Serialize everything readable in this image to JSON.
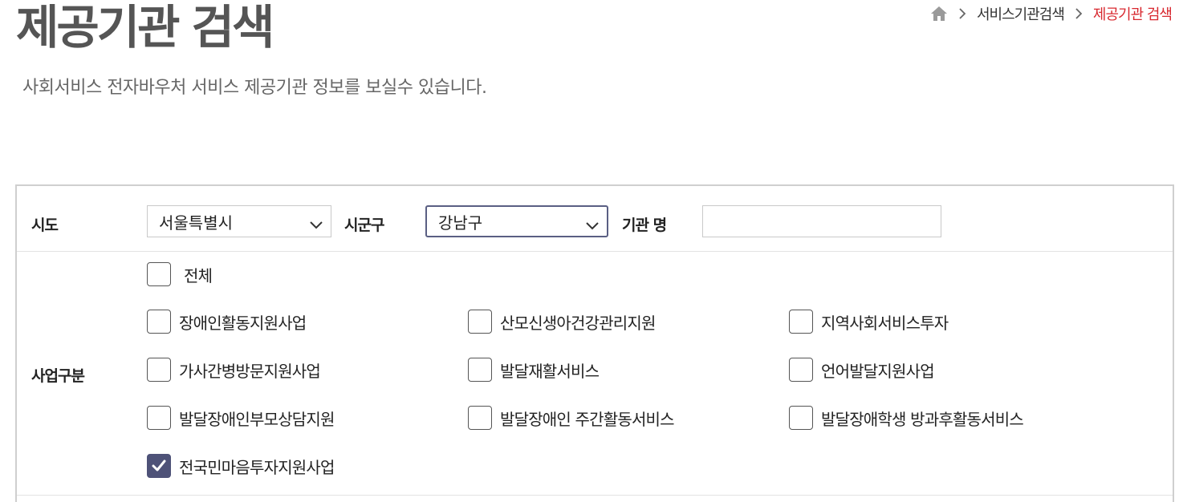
{
  "header": {
    "title": "제공기관 검색",
    "description": "사회서비스 전자바우처 서비스 제공기관 정보를 보실수 있습니다."
  },
  "breadcrumb": {
    "home_icon": "home-icon",
    "items": [
      "서비스기관검색",
      "제공기관 검색"
    ],
    "current_color": "#d8282f"
  },
  "search": {
    "sido_label": "시도",
    "sido_value": "서울특별시",
    "sigungu_label": "시군구",
    "sigungu_value": "강남구",
    "org_name_label": "기관 명",
    "org_name_value": "",
    "business_label": "사업구분",
    "all_label": "전체",
    "all_checked": false,
    "business_types": [
      {
        "label": "장애인활동지원사업",
        "checked": false
      },
      {
        "label": "산모신생아건강관리지원",
        "checked": false
      },
      {
        "label": "지역사회서비스투자",
        "checked": false
      },
      {
        "label": "가사간병방문지원사업",
        "checked": false
      },
      {
        "label": "발달재활서비스",
        "checked": false
      },
      {
        "label": "언어발달지원사업",
        "checked": false
      },
      {
        "label": "발달장애인부모상담지원",
        "checked": false
      },
      {
        "label": "발달장애인 주간활동서비스",
        "checked": false
      },
      {
        "label": "발달장애학생 방과후활동서비스",
        "checked": false
      },
      {
        "label": "전국민마음투자지원사업",
        "checked": true
      }
    ]
  },
  "colors": {
    "accent": "#4e5278",
    "title": "#555555",
    "breadcrumb_current": "#d8282f"
  }
}
